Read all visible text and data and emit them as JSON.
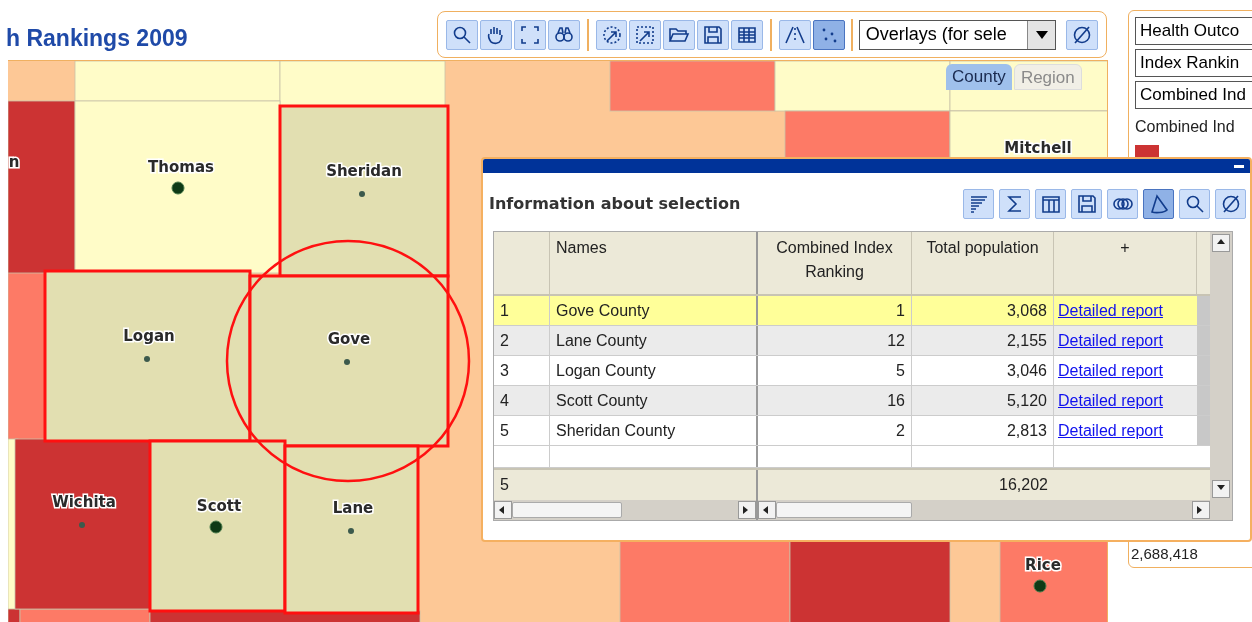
{
  "title": "h Rankings 2009",
  "toolbar": {
    "tool_groups": [
      [
        {
          "selected": false
        },
        {
          "selected": false
        },
        {
          "selected": false
        },
        {
          "selected": false
        }
      ],
      [
        {
          "selected": false
        },
        {
          "selected": false
        },
        {
          "selected": false
        },
        {
          "selected": false
        },
        {
          "selected": false
        }
      ],
      [
        {
          "selected": false
        },
        {
          "selected": true
        }
      ]
    ],
    "overlays_dropdown": {
      "value": "Overlays (for sele"
    }
  },
  "map_tabs": [
    {
      "label": "County",
      "selected": true
    },
    {
      "label": "Region",
      "selected": false
    }
  ],
  "map": {
    "counties": [
      {
        "name": "n",
        "color": "#cc3333",
        "selected": false
      },
      {
        "name": "Thomas",
        "color": "#fffcc8",
        "selected": false
      },
      {
        "name": "Sheridan",
        "color": "#e2dfb1",
        "selected": true
      },
      {
        "name": "Mitchell",
        "color": "#fffcc8",
        "selected": false
      },
      {
        "name": "Logan",
        "color": "#e2dfb1",
        "selected": true
      },
      {
        "name": "Gove",
        "color": "#e2dfb1",
        "selected": true
      },
      {
        "name": "Wichita",
        "color": "#cc3333",
        "selected": false
      },
      {
        "name": "Scott",
        "color": "#e2dfb1",
        "selected": true
      },
      {
        "name": "Lane",
        "color": "#e2dfb1",
        "selected": true
      },
      {
        "name": "Rice",
        "color": "#fd7a66",
        "selected": false
      }
    ]
  },
  "legend_panel": {
    "selectors": [
      {
        "value": "Health Outco"
      },
      {
        "value": "Index Rankin"
      },
      {
        "value": "Combined Ind"
      }
    ],
    "legend_title": "Combined Ind",
    "legend_items": [
      {
        "color": "#cc3333"
      }
    ],
    "total": "2,688,418"
  },
  "selection_window": {
    "title": "Information about selection",
    "tools": [
      {
        "selected": false
      },
      {
        "selected": false
      },
      {
        "selected": false
      },
      {
        "selected": false
      },
      {
        "selected": false
      },
      {
        "selected": true
      },
      {
        "selected": false
      },
      {
        "selected": false
      }
    ],
    "columns": [
      "Names",
      "Combined Index Ranking",
      "Total population",
      "+"
    ],
    "rows": [
      {
        "index": "1",
        "name": "Gove County",
        "ranking": "1",
        "population": "3,068",
        "link": "Detailed report",
        "selected": true
      },
      {
        "index": "2",
        "name": "Lane County",
        "ranking": "12",
        "population": "2,155",
        "link": "Detailed report",
        "selected": false
      },
      {
        "index": "3",
        "name": "Logan County",
        "ranking": "5",
        "population": "3,046",
        "link": "Detailed report",
        "selected": false
      },
      {
        "index": "4",
        "name": "Scott County",
        "ranking": "16",
        "population": "5,120",
        "link": "Detailed report",
        "selected": false
      },
      {
        "index": "5",
        "name": "Sheridan County",
        "ranking": "2",
        "population": "2,813",
        "link": "Detailed report",
        "selected": false
      }
    ],
    "footer": {
      "count": "5",
      "population": "16,202"
    }
  }
}
